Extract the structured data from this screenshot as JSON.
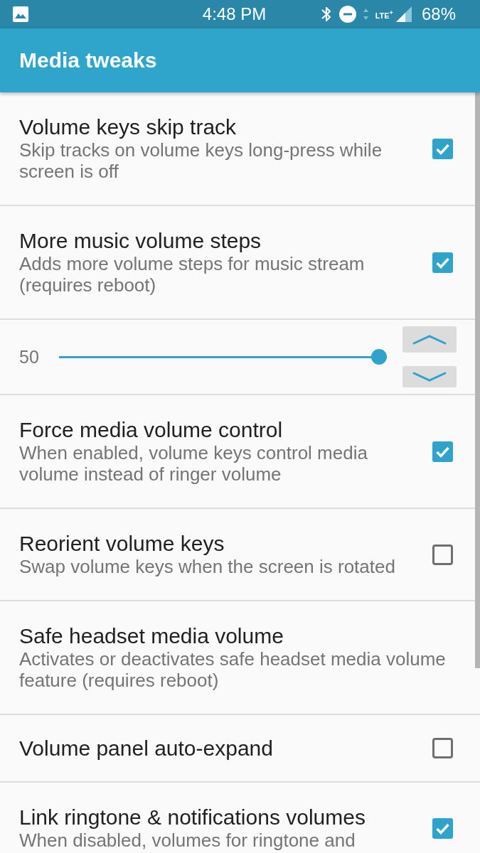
{
  "status_bar": {
    "time": "4:48 PM",
    "network": "LTE$^{+}$",
    "battery": "68%"
  },
  "app_bar": {
    "title": "Media tweaks"
  },
  "settings": [
    {
      "kind": "checkbox",
      "title": "Volume keys skip track",
      "summary": "Skip tracks on volume keys long-press while screen is off",
      "checked": true
    },
    {
      "kind": "checkbox",
      "title": "More music volume steps",
      "summary": "Adds more volume steps for music stream (requires reboot)",
      "checked": true
    },
    {
      "kind": "slider",
      "value": "50",
      "level": 1
    },
    {
      "kind": "checkbox",
      "title": "Force media volume control",
      "summary": "When enabled, volume keys control media volume instead of ringer volume",
      "checked": true
    },
    {
      "kind": "checkbox",
      "title": "Reorient volume keys",
      "summary": "Swap volume keys when the screen is rotated",
      "checked": false
    },
    {
      "kind": "plain",
      "title": "Safe headset media volume",
      "summary": "Activates or deactivates safe headset media volume feature (requires reboot)"
    },
    {
      "kind": "checkbox",
      "title": "Volume panel auto-expand",
      "checked": false
    },
    {
      "kind": "checkbox",
      "title": "Link ringtone & notifications volumes",
      "summary": "When disabled, volumes for ringtone and",
      "checked": true
    }
  ]
}
